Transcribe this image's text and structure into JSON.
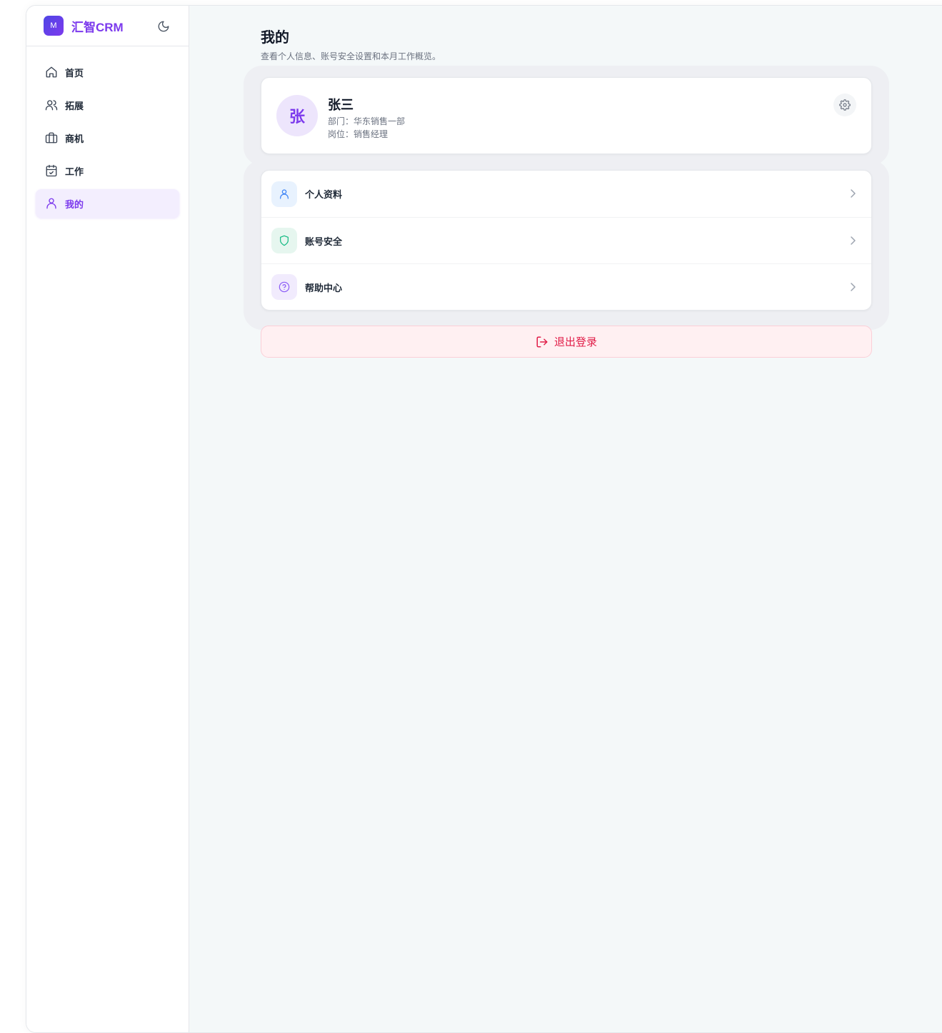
{
  "app": {
    "brand_name": "汇智CRM",
    "brand_logo_glyph": "M"
  },
  "sidebar": {
    "items": [
      {
        "label": "首页",
        "icon": "home-icon"
      },
      {
        "label": "拓展",
        "icon": "users-icon"
      },
      {
        "label": "商机",
        "icon": "briefcase-icon"
      },
      {
        "label": "工作",
        "icon": "calendar-check-icon"
      },
      {
        "label": "我的",
        "icon": "user-icon",
        "active": true
      }
    ]
  },
  "page": {
    "title": "我的",
    "subtitle": "查看个人信息、账号安全设置和本月工作概览。"
  },
  "profile": {
    "avatar_text": "张",
    "name": "张三",
    "department": "部门：华东销售一部",
    "position": "岗位：销售经理"
  },
  "menu": {
    "items": [
      {
        "label": "个人资料",
        "icon": "user-icon"
      },
      {
        "label": "账号安全",
        "icon": "shield-icon"
      },
      {
        "label": "帮助中心",
        "icon": "help-circle-icon"
      }
    ]
  },
  "logout": {
    "label": "退出登录"
  },
  "colors": {
    "accent": "#7c3aed",
    "danger": "#e11d48",
    "background": "#f4f8f9"
  }
}
